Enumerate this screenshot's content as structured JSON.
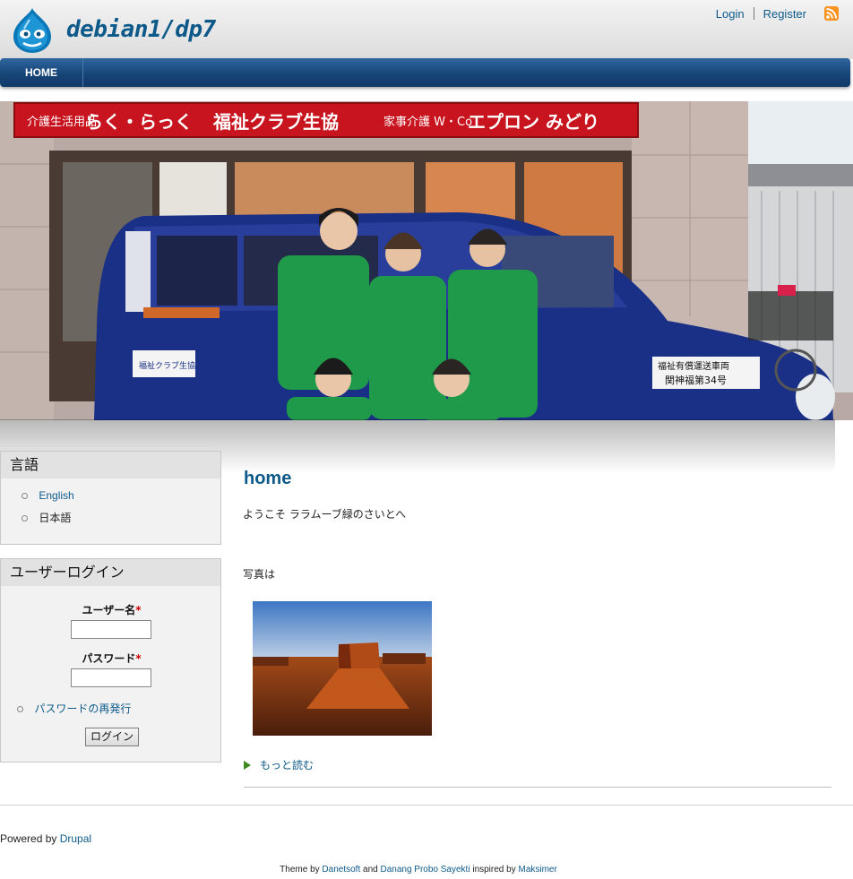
{
  "header": {
    "site_name": "debian1/dp7",
    "login_label": "Login",
    "register_label": "Register"
  },
  "nav": {
    "items": [
      {
        "label": "HOME"
      }
    ]
  },
  "banner": {
    "sign_texts": [
      "介護生活用品",
      "らく・らっく",
      "福祉クラブ生協",
      "家事介護 W・Co",
      "エプロン みどり"
    ],
    "vehicle_texts": [
      "福祉クラブ生協 らら・むーぶ 緑",
      "福祉有償運送車両",
      "関神福第34号"
    ]
  },
  "sidebar": {
    "language_block": {
      "title": "言語",
      "items": [
        {
          "label": "English",
          "link": true
        },
        {
          "label": "日本語",
          "link": false
        }
      ]
    },
    "login_block": {
      "title": "ユーザーログイン",
      "username_label": "ユーザー名",
      "password_label": "パスワード",
      "required_mark": "*",
      "reset_password_label": "パスワードの再発行",
      "login_button_label": "ログイン"
    }
  },
  "main": {
    "title": "home",
    "welcome_text": "ようこそ ララムーブ緑のさいとへ",
    "photo_label": "写真は",
    "read_more_label": "もっと読む"
  },
  "footer": {
    "powered_prefix": "Powered by ",
    "powered_link": "Drupal",
    "credits": {
      "prefix": "Theme by ",
      "author1": "Danetsoft",
      "and": " and ",
      "author2": "Danang Probo Sayekti",
      "inspired": " inspired by ",
      "author3": "Maksimer"
    }
  },
  "colors": {
    "link": "#0d5a8a",
    "nav_bar": "#174577",
    "required": "#cc0000",
    "rss": "#f7931e"
  }
}
